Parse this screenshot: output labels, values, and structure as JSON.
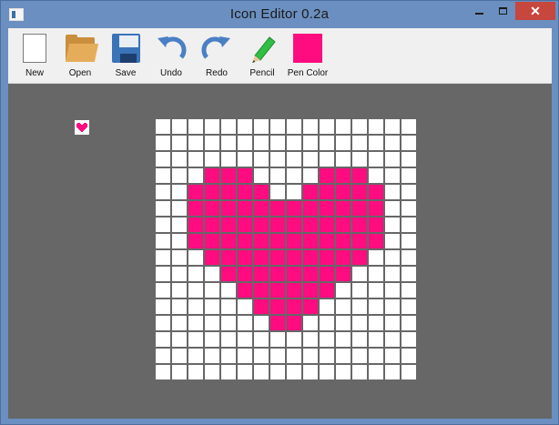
{
  "window": {
    "title": "Icon Editor 0.2a",
    "close_glyph": "✕"
  },
  "toolbar": {
    "items": [
      {
        "id": "new",
        "label": "New",
        "icon": "new-file-icon"
      },
      {
        "id": "open",
        "label": "Open",
        "icon": "folder-icon"
      },
      {
        "id": "save",
        "label": "Save",
        "icon": "floppy-disk-icon"
      },
      {
        "id": "undo",
        "label": "Undo",
        "icon": "undo-arrow-icon"
      },
      {
        "id": "redo",
        "label": "Redo",
        "icon": "redo-arrow-icon"
      },
      {
        "id": "pencil",
        "label": "Pencil",
        "icon": "pencil-icon"
      },
      {
        "id": "pen_color",
        "label": "Pen Color",
        "icon": "color-swatch-icon"
      }
    ]
  },
  "colors": {
    "pen": "#ff0d80",
    "blank": "#ffffff",
    "canvas_bg": "#676767",
    "undo_redo": "#4a7fc4",
    "pencil": "#2fbf45"
  },
  "editor": {
    "grid_size": 16,
    "pixels": [
      "0000000000000000",
      "0000000000000000",
      "0000000000000000",
      "0001110000111000",
      "0011111001111100",
      "0011111111111100",
      "0011111111111100",
      "0011111111111100",
      "0001111111111000",
      "0000111111110000",
      "0000011111100000",
      "0000001111000000",
      "0000000110000000",
      "0000000000000000",
      "0000000000000000",
      "0000000000000000"
    ]
  }
}
